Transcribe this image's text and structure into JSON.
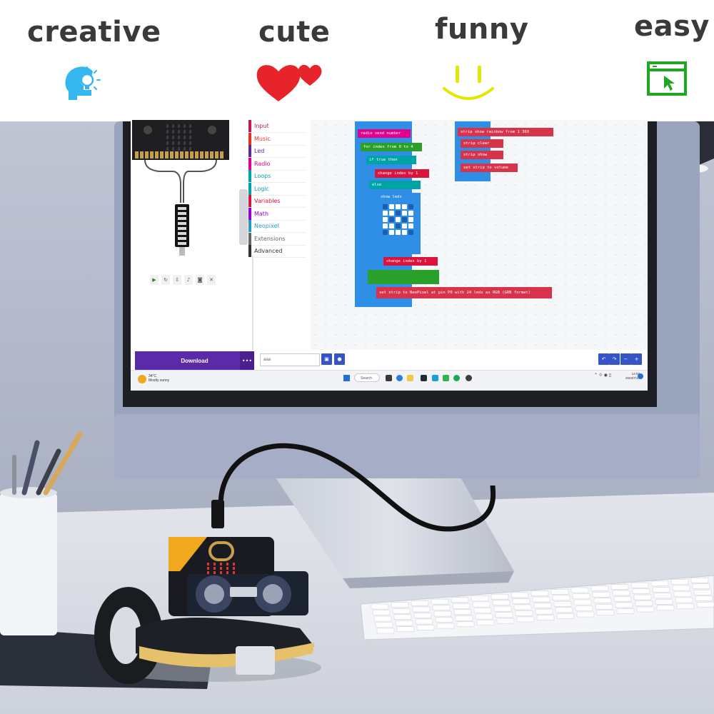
{
  "banner": {
    "words": [
      "creative",
      "cute",
      "funny",
      "easy"
    ],
    "icons": [
      "head-lightbulb-icon",
      "hearts-icon",
      "smiley-face-icon",
      "browser-cursor-icon"
    ],
    "colors": {
      "word": "#3a3a3a",
      "creative_icon": "#34b6ee",
      "heart": "#e8242b",
      "smiley": "#e4e600",
      "easy_icon": "#1fa622"
    }
  },
  "screen": {
    "categories": [
      "Input",
      "Music",
      "Led",
      "Radio",
      "Loops",
      "Logic",
      "Variables",
      "Math",
      "Neopixel",
      "Extensions",
      "Advanced"
    ],
    "category_colors": [
      "#c2185b",
      "#e63022",
      "#5c2d91",
      "#e3008c",
      "#00a4a6",
      "#00a4a6",
      "#dc143c",
      "#9400d3",
      "#2699bf",
      "#666666",
      "#333333"
    ],
    "blocks": {
      "radio_send": "radio send number",
      "for_loop": "for index from 0 to",
      "for_to": "4",
      "if_true": "true",
      "if_then": "then",
      "change_index_1": "change index by",
      "change_index_1_val": "1",
      "else": "else",
      "show_leds": "show leds",
      "change_index_2": "change index by",
      "change_index_2_val": "1",
      "set_strip": "set strip to NeoPixel at pin P0 with",
      "leds_count": "24",
      "leds_as": "leds as RGB (GRB format)",
      "show_rainbow": "strip show rainbow from",
      "rainbow_from": "1",
      "rainbow_to": "360",
      "clear": "strip clear",
      "show": "strip show",
      "set_volume": "set strip to volume"
    },
    "download_label": "Download",
    "more_label": "•••",
    "project_name": "aaa",
    "taskbar_search": "Search",
    "weather_temp": "34°C",
    "weather_desc": "Mostly sunny",
    "clock_time": "14:02",
    "clock_date": "2023/7/17"
  }
}
